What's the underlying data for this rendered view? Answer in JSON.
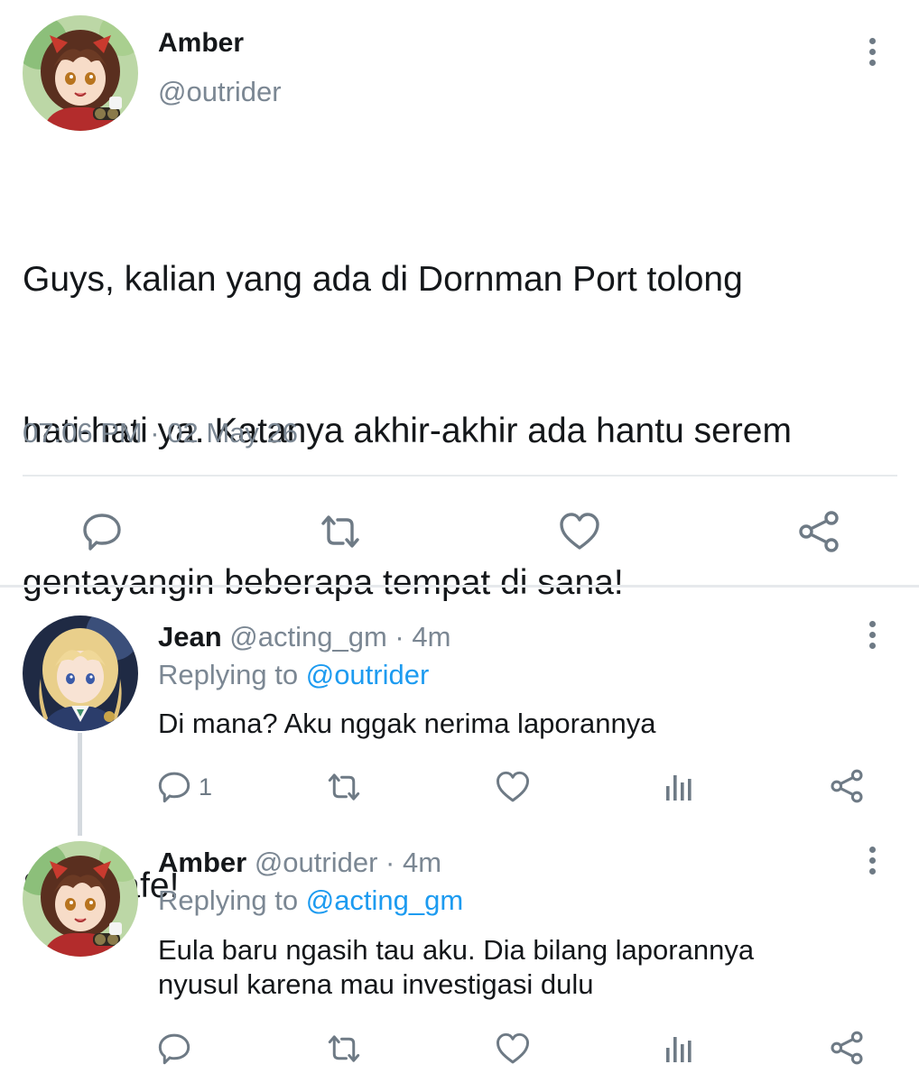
{
  "main_tweet": {
    "author_name": "Amber",
    "author_handle": "@outrider",
    "text_lines": [
      "Guys, kalian yang ada di Dornman Port tolong",
      "hati-hati ya. Katanya akhir-akhir ada hantu serem",
      "gentayangin beberapa tempat di sana!",
      "",
      "Stay safe!"
    ],
    "timestamp": "07:06 PM · 02 May 26",
    "actions": [
      "reply-icon",
      "retweet-icon",
      "like-icon",
      "share-icon"
    ]
  },
  "replies": [
    {
      "author_name": "Jean",
      "author_handle": "@acting_gm",
      "time": " · 4m",
      "replying_prefix": "Replying to ",
      "replying_handle": "@outrider",
      "text": "Di mana? Aku nggak nerima laporannya",
      "reply_count": "1"
    },
    {
      "author_name": "Amber",
      "author_handle": "@outrider",
      "time": " · 4m",
      "replying_prefix": "Replying to ",
      "replying_handle": "@acting_gm",
      "text_lines": [
        "Eula baru ngasih tau aku. Dia bilang laporannya",
        "nyusul karena mau investigasi dulu"
      ],
      "reply_count": ""
    }
  ],
  "colors": {
    "link": "#1d9bf0",
    "muted": "#7b8793",
    "icon": "#6e7a85",
    "divider": "#e7eaed"
  }
}
